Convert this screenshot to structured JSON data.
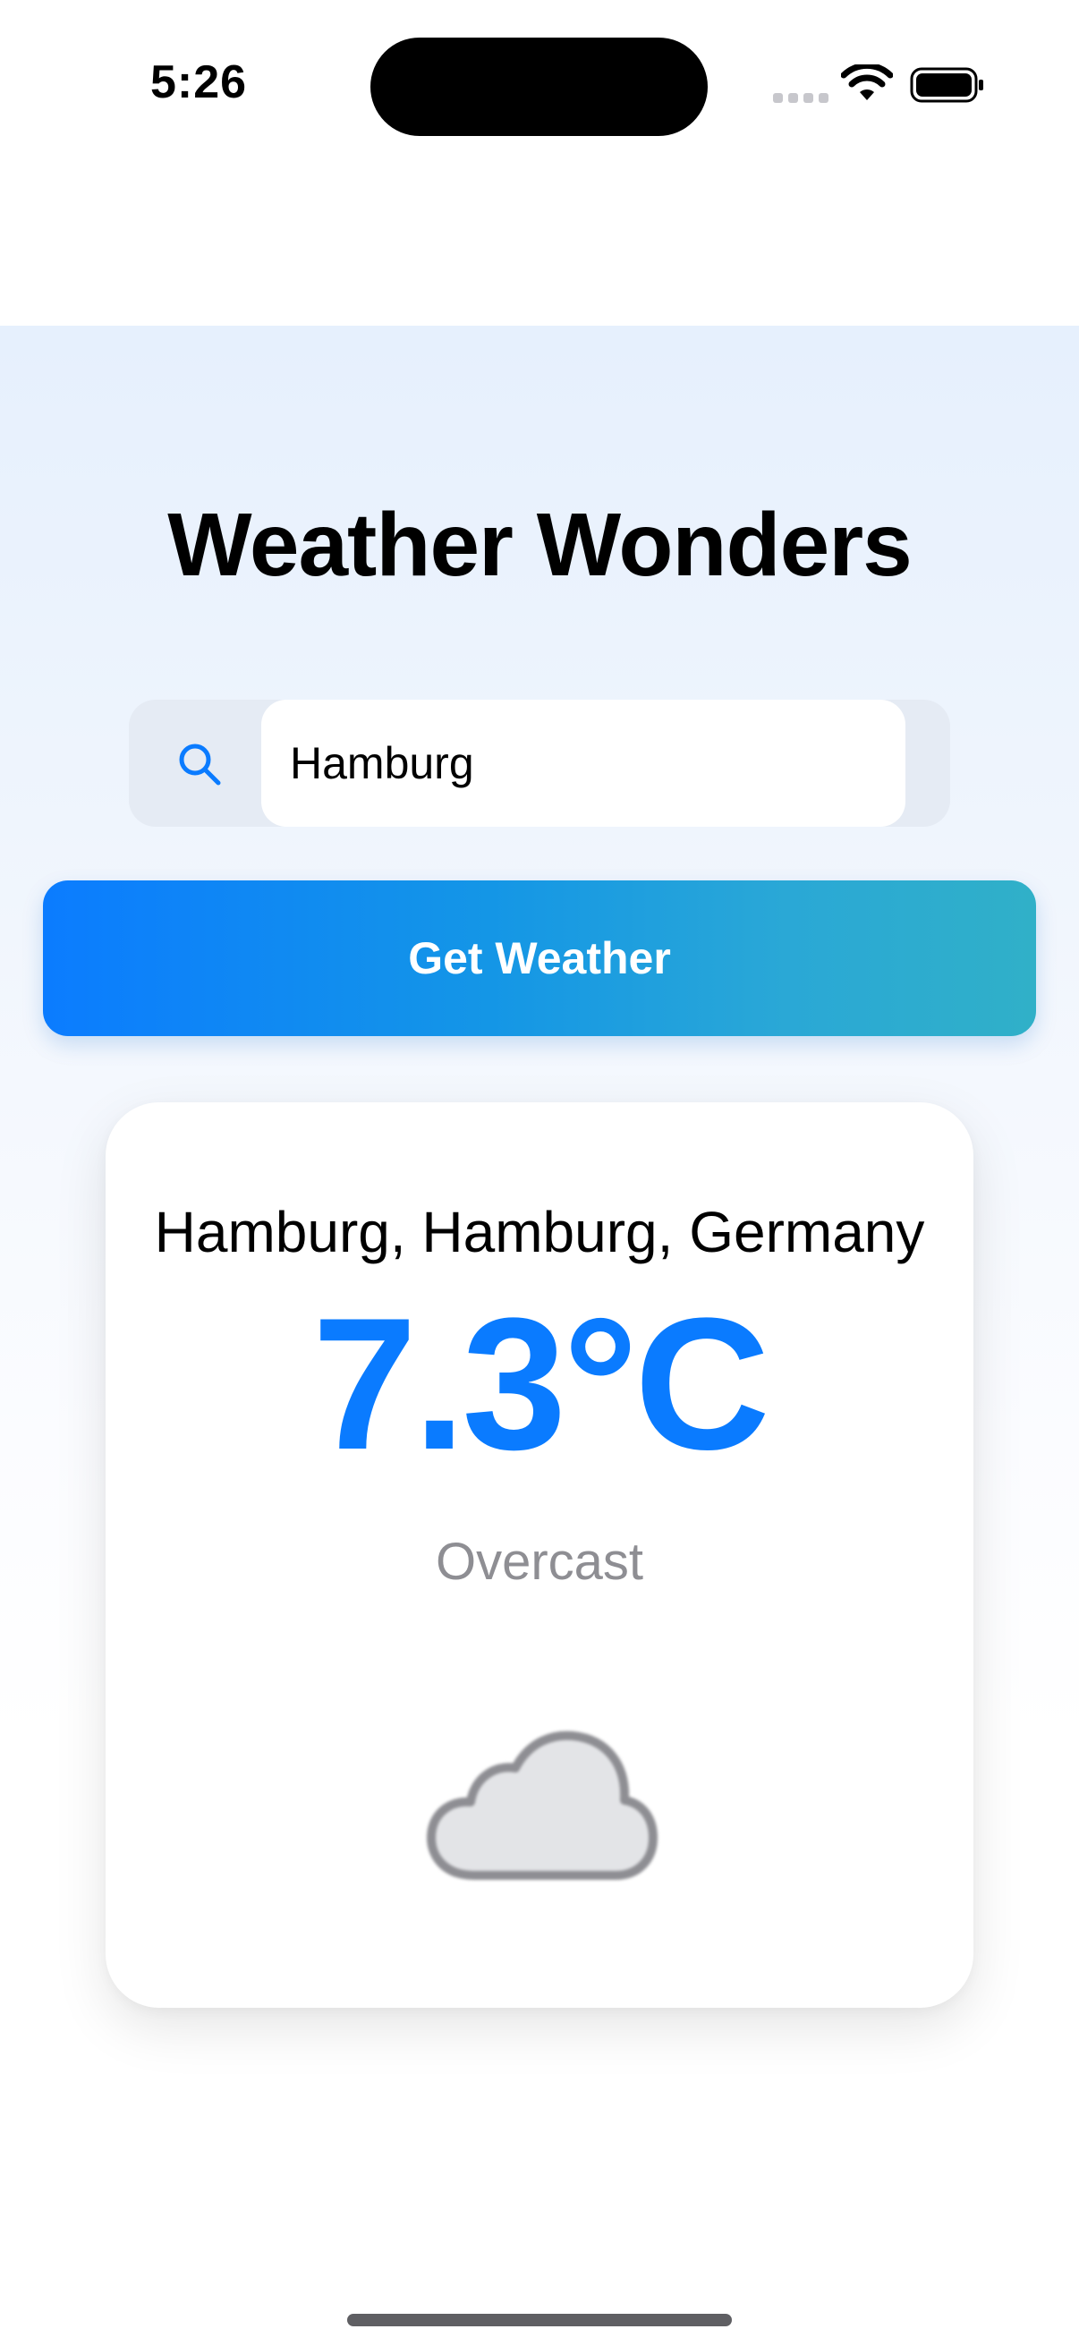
{
  "status_bar": {
    "time": "5:26"
  },
  "app": {
    "title": "Weather Wonders"
  },
  "search": {
    "value": "Hamburg",
    "icon": "search-icon"
  },
  "actions": {
    "get_weather_label": "Get Weather"
  },
  "weather": {
    "location": "Hamburg, Hamburg, Germany",
    "temperature": "7.3°C",
    "condition": "Overcast",
    "icon": "cloud-icon"
  },
  "colors": {
    "accent": "#0a7bff",
    "button_gradient_start": "#0b7cff",
    "button_gradient_end": "#30b0c8",
    "condition_text": "#8e8e93",
    "cloud_fill": "#e3e4e7",
    "cloud_stroke": "#8e8e93"
  }
}
